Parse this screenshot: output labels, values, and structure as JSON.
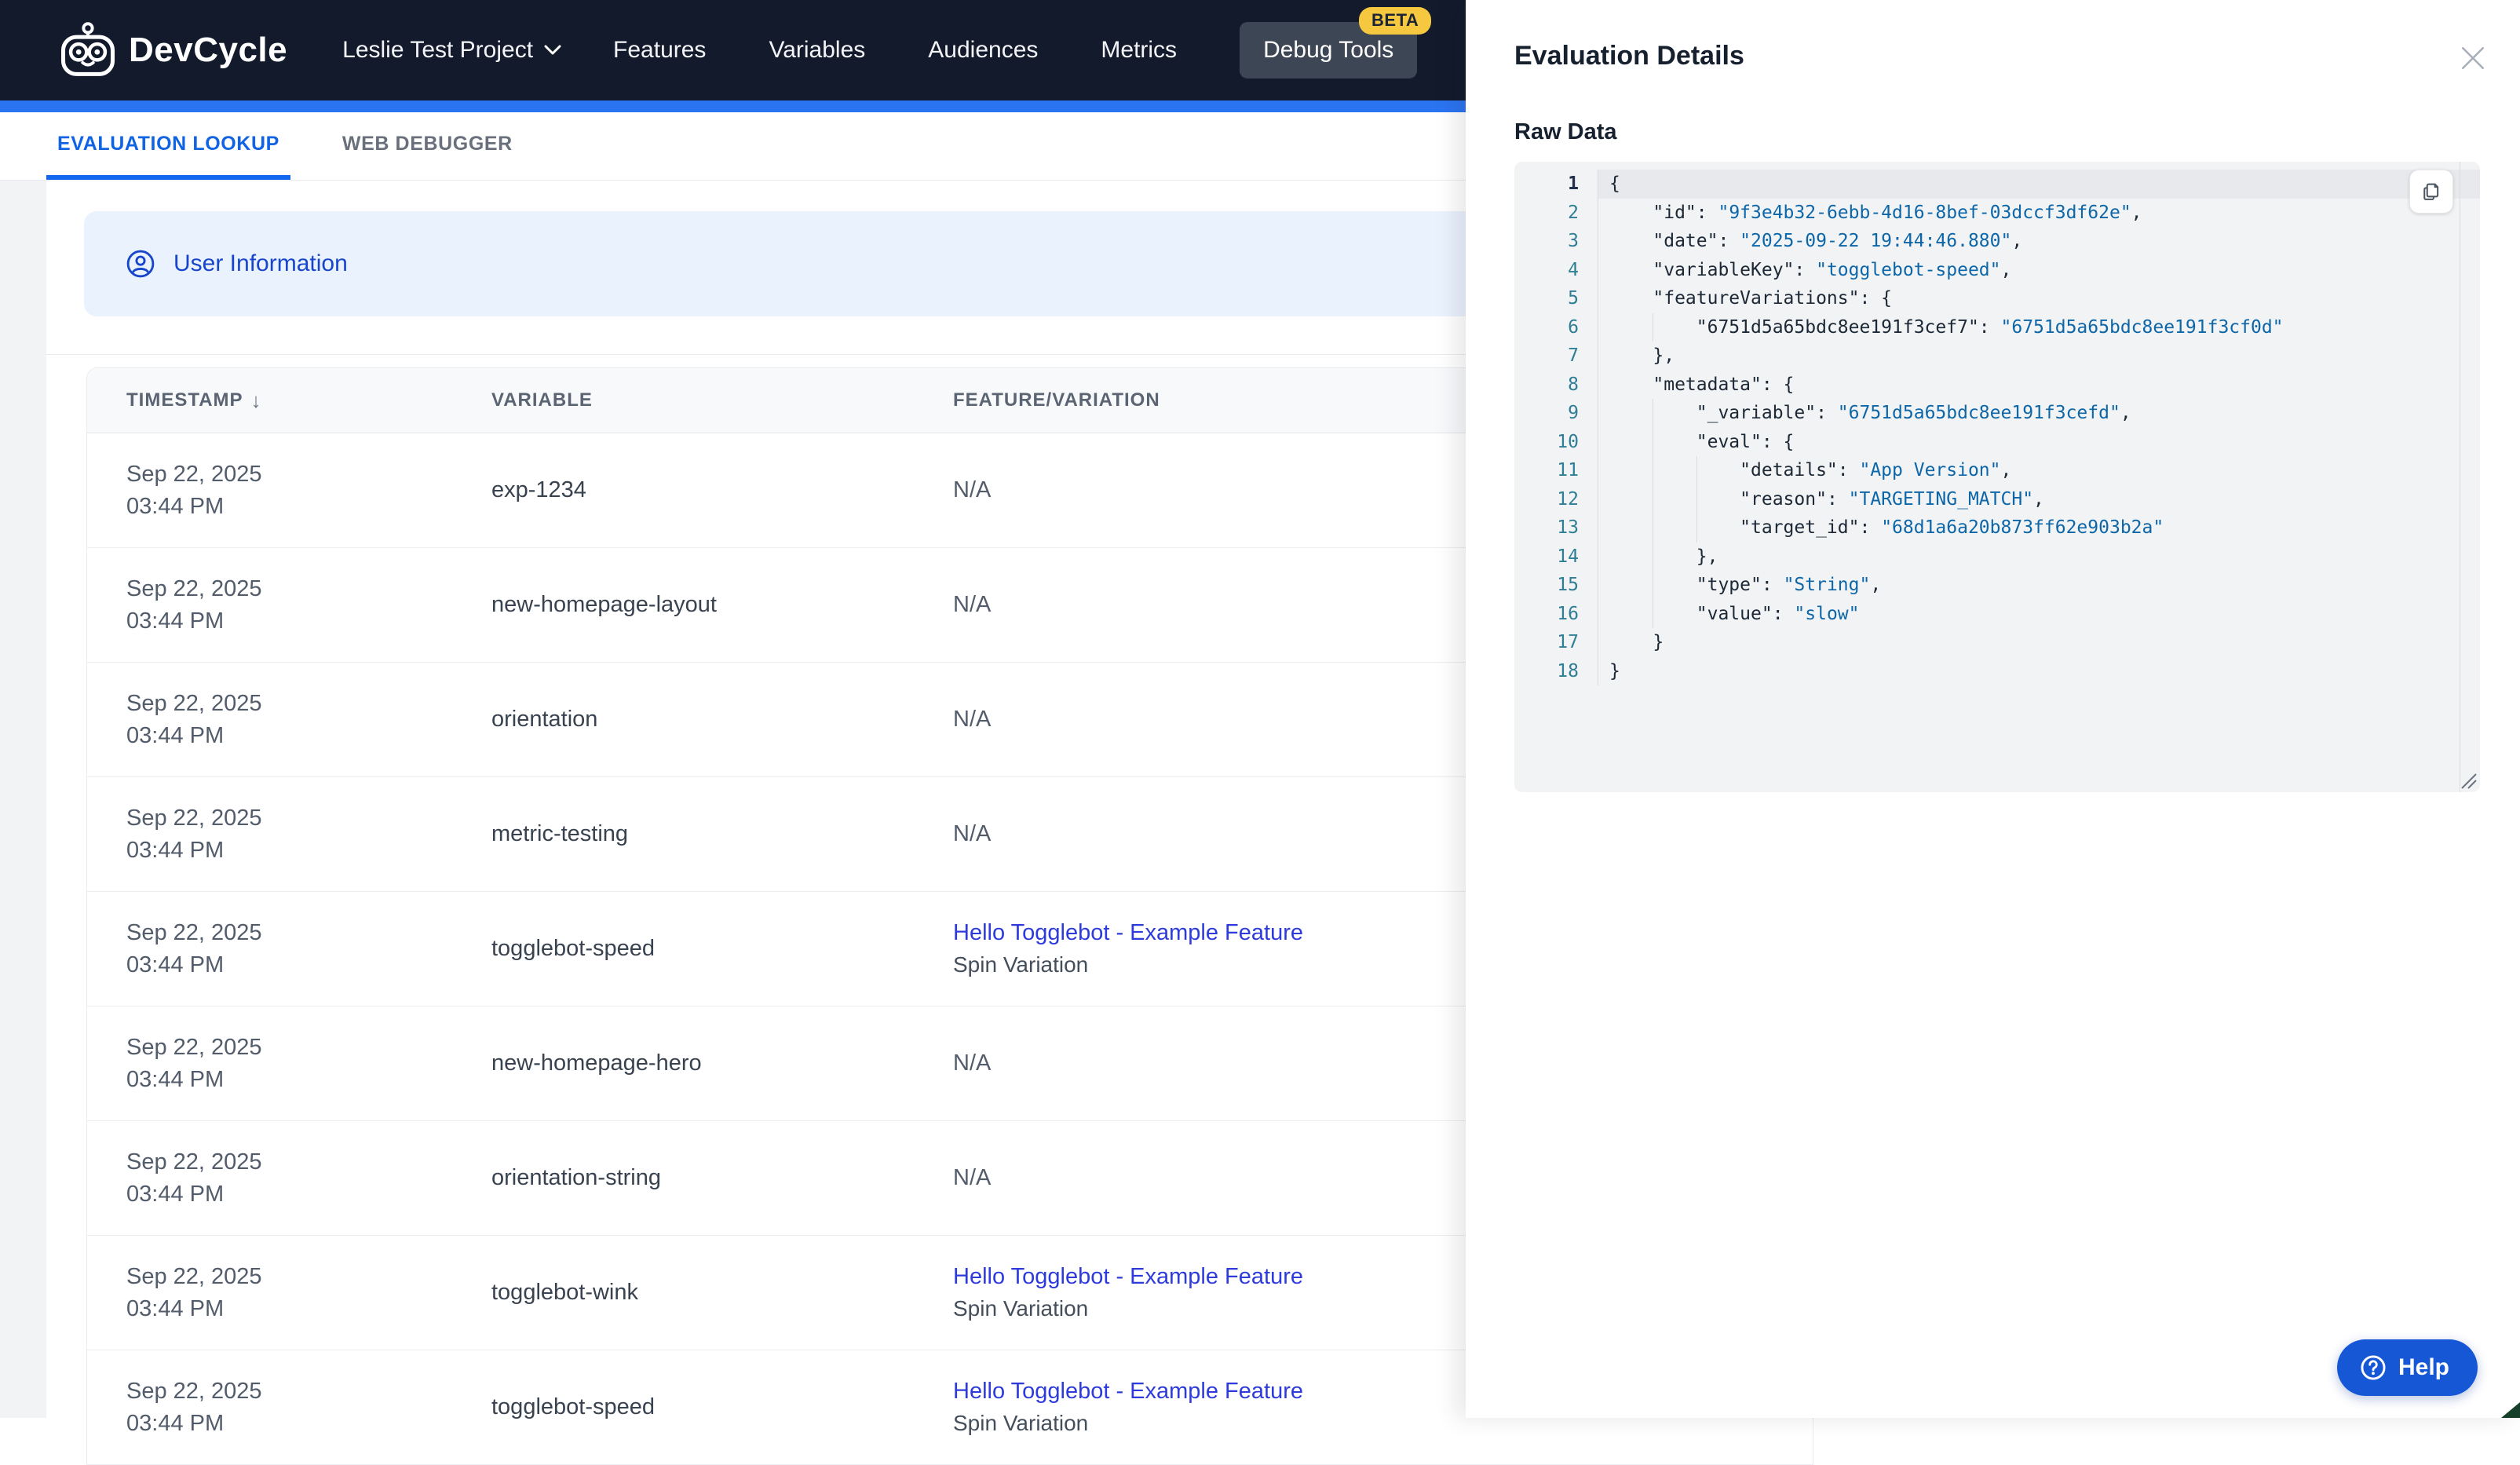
{
  "header": {
    "brand": "DevCycle",
    "project": "Leslie Test Project",
    "nav": [
      "Features",
      "Variables",
      "Audiences",
      "Metrics"
    ],
    "debug_tools_label": "Debug Tools",
    "beta_label": "BETA"
  },
  "tabs": [
    {
      "label": "EVALUATION LOOKUP",
      "active": true
    },
    {
      "label": "WEB DEBUGGER",
      "active": false
    }
  ],
  "user_banner": {
    "label": "User Information"
  },
  "table": {
    "columns": [
      "TIMESTAMP",
      "VARIABLE",
      "FEATURE/VARIATION"
    ],
    "sort_icon": "↓",
    "na_label": "N/A",
    "rows": [
      {
        "date": "Sep 22, 2025",
        "time": "03:44 PM",
        "variable": "exp-1234",
        "feature": null
      },
      {
        "date": "Sep 22, 2025",
        "time": "03:44 PM",
        "variable": "new-homepage-layout",
        "feature": null
      },
      {
        "date": "Sep 22, 2025",
        "time": "03:44 PM",
        "variable": "orientation",
        "feature": null
      },
      {
        "date": "Sep 22, 2025",
        "time": "03:44 PM",
        "variable": "metric-testing",
        "feature": null
      },
      {
        "date": "Sep 22, 2025",
        "time": "03:44 PM",
        "variable": "togglebot-speed",
        "feature": {
          "name": "Hello Togglebot - Example Feature",
          "variation": "Spin Variation"
        }
      },
      {
        "date": "Sep 22, 2025",
        "time": "03:44 PM",
        "variable": "new-homepage-hero",
        "feature": null
      },
      {
        "date": "Sep 22, 2025",
        "time": "03:44 PM",
        "variable": "orientation-string",
        "feature": null
      },
      {
        "date": "Sep 22, 2025",
        "time": "03:44 PM",
        "variable": "togglebot-wink",
        "feature": {
          "name": "Hello Togglebot - Example Feature",
          "variation": "Spin Variation"
        }
      },
      {
        "date": "Sep 22, 2025",
        "time": "03:44 PM",
        "variable": "togglebot-speed",
        "feature": {
          "name": "Hello Togglebot - Example Feature",
          "variation": "Spin Variation"
        }
      }
    ]
  },
  "panel": {
    "title": "Evaluation Details",
    "section_label": "Raw Data",
    "code": {
      "lines": [
        {
          "n": 1,
          "ind": 0,
          "active": true,
          "segs": [
            [
              "p",
              "{"
            ]
          ]
        },
        {
          "n": 2,
          "ind": 1,
          "segs": [
            [
              "k",
              "\"id\""
            ],
            [
              "p",
              ": "
            ],
            [
              "s",
              "\"9f3e4b32-6ebb-4d16-8bef-03dccf3df62e\""
            ],
            [
              "p",
              ","
            ]
          ]
        },
        {
          "n": 3,
          "ind": 1,
          "segs": [
            [
              "k",
              "\"date\""
            ],
            [
              "p",
              ": "
            ],
            [
              "s",
              "\"2025-09-22 19:44:46.880\""
            ],
            [
              "p",
              ","
            ]
          ]
        },
        {
          "n": 4,
          "ind": 1,
          "segs": [
            [
              "k",
              "\"variableKey\""
            ],
            [
              "p",
              ": "
            ],
            [
              "s",
              "\"togglebot-speed\""
            ],
            [
              "p",
              ","
            ]
          ]
        },
        {
          "n": 5,
          "ind": 1,
          "segs": [
            [
              "k",
              "\"featureVariations\""
            ],
            [
              "p",
              ": {"
            ]
          ]
        },
        {
          "n": 6,
          "ind": 2,
          "segs": [
            [
              "k",
              "\"6751d5a65bdc8ee191f3cef7\""
            ],
            [
              "p",
              ": "
            ],
            [
              "s",
              "\"6751d5a65bdc8ee191f3cf0d\""
            ]
          ]
        },
        {
          "n": 7,
          "ind": 1,
          "segs": [
            [
              "p",
              "},"
            ]
          ]
        },
        {
          "n": 8,
          "ind": 1,
          "segs": [
            [
              "k",
              "\"metadata\""
            ],
            [
              "p",
              ": {"
            ]
          ]
        },
        {
          "n": 9,
          "ind": 2,
          "segs": [
            [
              "k",
              "\"_variable\""
            ],
            [
              "p",
              ": "
            ],
            [
              "s",
              "\"6751d5a65bdc8ee191f3cefd\""
            ],
            [
              "p",
              ","
            ]
          ]
        },
        {
          "n": 10,
          "ind": 2,
          "segs": [
            [
              "k",
              "\"eval\""
            ],
            [
              "p",
              ": {"
            ]
          ]
        },
        {
          "n": 11,
          "ind": 3,
          "segs": [
            [
              "k",
              "\"details\""
            ],
            [
              "p",
              ": "
            ],
            [
              "s",
              "\"App Version\""
            ],
            [
              "p",
              ","
            ]
          ]
        },
        {
          "n": 12,
          "ind": 3,
          "segs": [
            [
              "k",
              "\"reason\""
            ],
            [
              "p",
              ": "
            ],
            [
              "s",
              "\"TARGETING_MATCH\""
            ],
            [
              "p",
              ","
            ]
          ]
        },
        {
          "n": 13,
          "ind": 3,
          "segs": [
            [
              "k",
              "\"target_id\""
            ],
            [
              "p",
              ": "
            ],
            [
              "s",
              "\"68d1a6a20b873ff62e903b2a\""
            ]
          ]
        },
        {
          "n": 14,
          "ind": 2,
          "segs": [
            [
              "p",
              "},"
            ]
          ]
        },
        {
          "n": 15,
          "ind": 2,
          "segs": [
            [
              "k",
              "\"type\""
            ],
            [
              "p",
              ": "
            ],
            [
              "s",
              "\"String\""
            ],
            [
              "p",
              ","
            ]
          ]
        },
        {
          "n": 16,
          "ind": 2,
          "segs": [
            [
              "k",
              "\"value\""
            ],
            [
              "p",
              ": "
            ],
            [
              "s",
              "\"slow\""
            ]
          ]
        },
        {
          "n": 17,
          "ind": 1,
          "segs": [
            [
              "p",
              "}"
            ]
          ]
        },
        {
          "n": 18,
          "ind": 0,
          "segs": [
            [
              "p",
              "}"
            ]
          ]
        }
      ]
    }
  },
  "help": {
    "label": "Help"
  },
  "colors": {
    "header_bg": "#121a2b",
    "accent_bar": "#2b74f1",
    "active_tab": "#1064e3",
    "banner_bg": "#eaf2fd",
    "banner_text": "#1745cb",
    "feature_link": "#2e3bdb",
    "code_string": "#0d66a8",
    "code_line_number": "#2f7e95",
    "badge_yellow": "#f6c83f",
    "help_button": "#1657d6"
  }
}
